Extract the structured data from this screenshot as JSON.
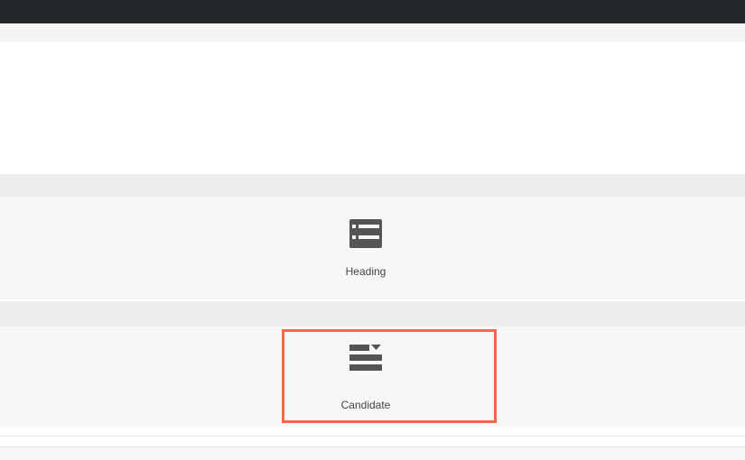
{
  "widgets": [
    {
      "label": "Heading",
      "icon": "list-heading-icon"
    },
    {
      "label": "Candidate",
      "icon": "list-dropdown-icon"
    }
  ],
  "colors": {
    "topbar": "#23282d",
    "highlight": "#ee6a4d",
    "icon": "#555555",
    "label": "#444444"
  }
}
